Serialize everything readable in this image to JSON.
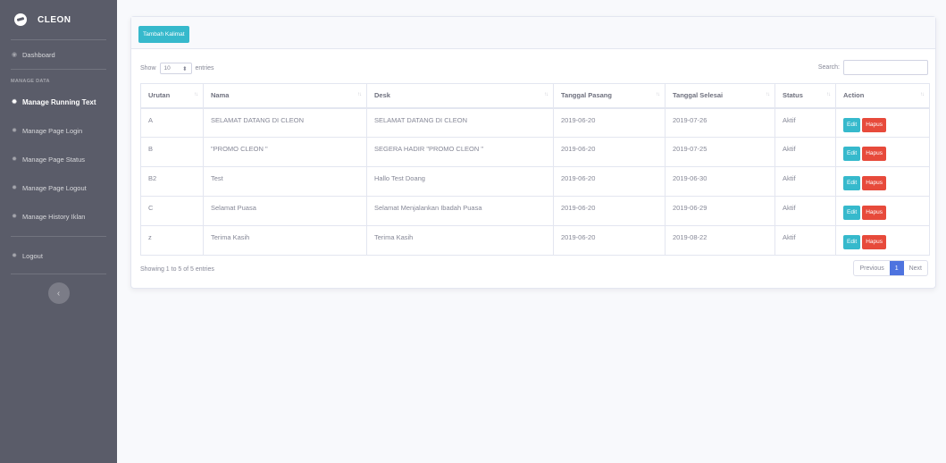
{
  "sidebar": {
    "brand": "CLEON",
    "items": [
      {
        "label": "Dashboard",
        "icon": "dashboard-icon"
      },
      {
        "label": "Manage Running Text",
        "icon": "gear-icon"
      },
      {
        "label": "Manage Page Login",
        "icon": "gear-icon"
      },
      {
        "label": "Manage Page Status",
        "icon": "gear-icon"
      },
      {
        "label": "Manage Page Logout",
        "icon": "gear-icon"
      },
      {
        "label": "Manage History Iklan",
        "icon": "gear-icon"
      },
      {
        "label": "Logout",
        "icon": "gear-icon"
      }
    ],
    "heading": "MANAGE DATA",
    "toggle_icon": "chevron-left-icon"
  },
  "card": {
    "add_button": "Tambah Kalimat",
    "show_label": "Show",
    "entries_value": "10",
    "entries_label": "entries",
    "search_label": "Search:",
    "info": "Showing 1 to 5 of 5 entries",
    "pager": {
      "prev": "Previous",
      "current": "1",
      "next": "Next"
    }
  },
  "table": {
    "headers": [
      "Urutan",
      "Nama",
      "Desk",
      "Tanggal Pasang",
      "Tanggal Selesai",
      "Status",
      "Action"
    ],
    "rows": [
      [
        "A",
        "SELAMAT DATANG DI CLEON",
        "SELAMAT DATANG DI CLEON",
        "2019-06-20",
        "2019-07-26",
        "Aktif"
      ],
      [
        "B",
        "\"PROMO CLEON \"",
        "SEGERA HADIR \"PROMO CLEON \"",
        "2019-06-20",
        "2019-07-25",
        "Aktif"
      ],
      [
        "B2",
        "Test",
        "Hallo Test Doang",
        "2019-06-20",
        "2019-06-30",
        "Aktif"
      ],
      [
        "C",
        "Selamat Puasa",
        "Selamat Menjalankan Ibadah Puasa",
        "2019-06-20",
        "2019-06-29",
        "Aktif"
      ],
      [
        "z",
        "Terima Kasih",
        "Terima Kasih",
        "2019-06-20",
        "2019-08-22",
        "Aktif"
      ]
    ],
    "edit_label": "Edit",
    "delete_label": "Hapus"
  },
  "colors": {
    "sidebar": "#5a5c69",
    "info": "#36b9cc",
    "danger": "#e74a3b",
    "primary": "#4e73df"
  }
}
